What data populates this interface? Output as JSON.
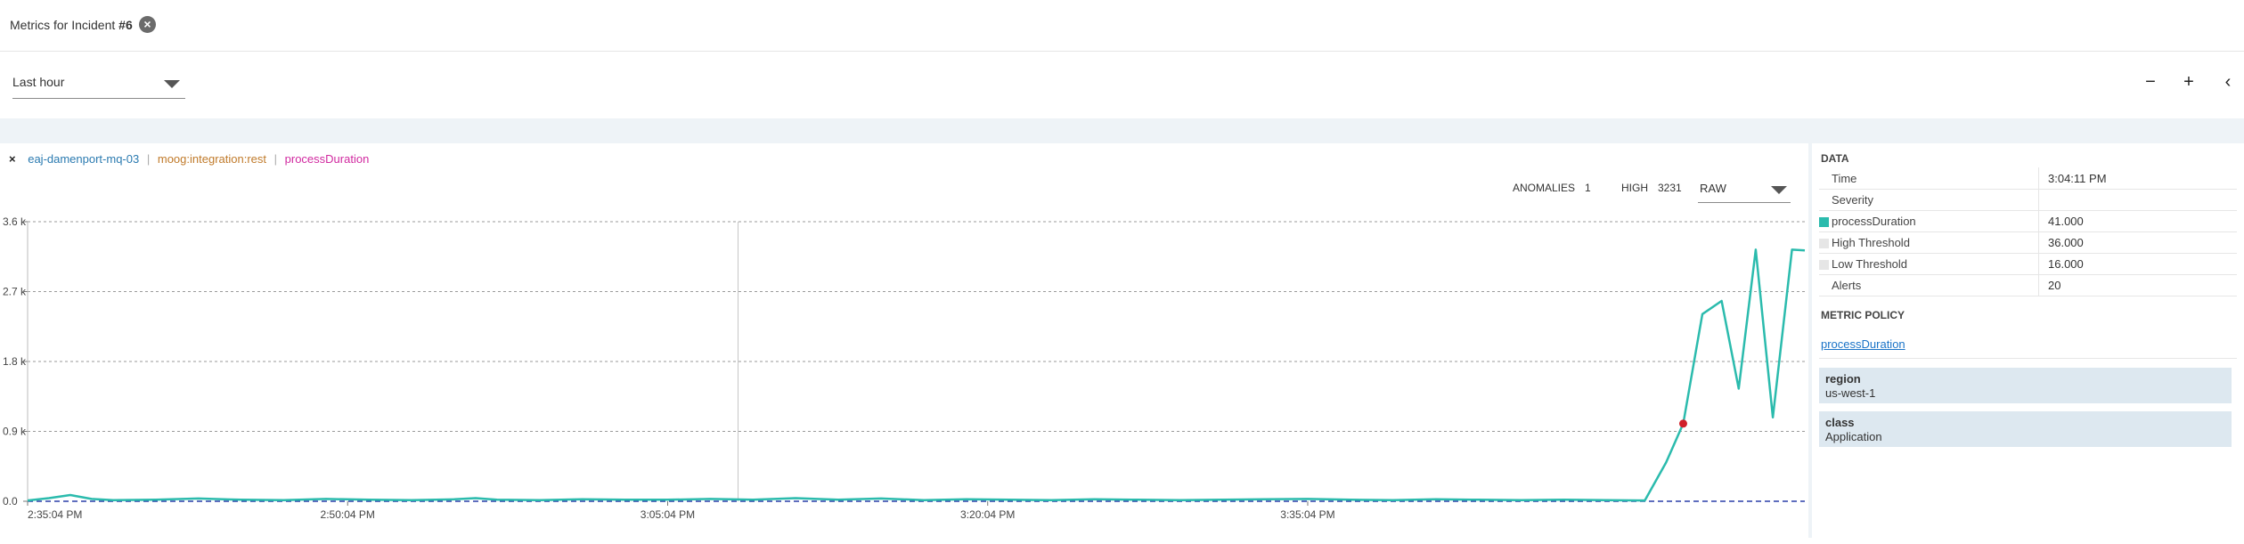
{
  "header": {
    "title_prefix": "Metrics for Incident",
    "title_num": "#6"
  },
  "toolbar": {
    "time_range": "Last hour",
    "buttons": {
      "zoom_out": "−",
      "zoom_in": "+",
      "collapse": "‹"
    }
  },
  "legend": {
    "close": "×",
    "host": "eaj-damenport-mq-03",
    "source": "moog:integration:rest",
    "metric": "processDuration",
    "separator": "|"
  },
  "stats": {
    "anomalies_label": "ANOMALIES",
    "anomalies_value": "1",
    "high_label": "HIGH",
    "high_value": "3231",
    "mode": "RAW"
  },
  "data_panel": {
    "heading": "DATA",
    "rows": [
      {
        "label": "Time",
        "value": "3:04:11 PM"
      },
      {
        "label": "Severity",
        "value": ""
      },
      {
        "label": "processDuration",
        "value": "41.000",
        "swatch": "#2bbbad"
      },
      {
        "label": "High Threshold",
        "value": "36.000",
        "swatch": "#e6e6e6"
      },
      {
        "label": "Low Threshold",
        "value": "16.000",
        "swatch": "#e6e6e6"
      },
      {
        "label": "Alerts",
        "value": "20"
      }
    ],
    "policy_heading": "METRIC POLICY",
    "policy_link": "processDuration",
    "tags": [
      {
        "key": "region",
        "value": "us-west-1"
      },
      {
        "key": "class",
        "value": "Application"
      }
    ]
  },
  "colors": {
    "line": "#2bbbad",
    "anomaly": "#d0202a",
    "baseline": "#2a3fa8",
    "accent": "#1a73c7"
  },
  "chart_data": {
    "type": "line",
    "xlabel": "",
    "ylabel": "",
    "y_ticks": [
      "0.0",
      "0.9 k",
      "1.8 k",
      "2.7 k",
      "3.6 k"
    ],
    "x_ticks": [
      "2:35:04 PM",
      "2:50:04 PM",
      "3:05:04 PM",
      "3:20:04 PM",
      "3:35:04 PM"
    ],
    "ylim": [
      0,
      3600
    ],
    "xlim_minutes": [
      0,
      82
    ],
    "grid": true,
    "cursor_minute": 33.3,
    "baseline_value": 0,
    "series": [
      {
        "name": "processDuration",
        "points": [
          [
            0,
            10
          ],
          [
            1,
            40
          ],
          [
            2,
            80
          ],
          [
            3,
            30
          ],
          [
            4,
            15
          ],
          [
            6,
            20
          ],
          [
            8,
            35
          ],
          [
            10,
            20
          ],
          [
            12,
            15
          ],
          [
            14,
            30
          ],
          [
            16,
            20
          ],
          [
            18,
            15
          ],
          [
            20,
            25
          ],
          [
            21,
            40
          ],
          [
            22,
            20
          ],
          [
            24,
            15
          ],
          [
            26,
            25
          ],
          [
            28,
            20
          ],
          [
            30,
            20
          ],
          [
            32,
            30
          ],
          [
            34,
            20
          ],
          [
            36,
            40
          ],
          [
            38,
            20
          ],
          [
            40,
            35
          ],
          [
            42,
            15
          ],
          [
            44,
            25
          ],
          [
            46,
            20
          ],
          [
            48,
            15
          ],
          [
            50,
            25
          ],
          [
            52,
            20
          ],
          [
            54,
            15
          ],
          [
            56,
            20
          ],
          [
            58,
            25
          ],
          [
            60,
            30
          ],
          [
            62,
            20
          ],
          [
            64,
            15
          ],
          [
            66,
            25
          ],
          [
            68,
            20
          ],
          [
            70,
            15
          ],
          [
            72,
            20
          ],
          [
            74,
            15
          ],
          [
            75.8,
            10
          ],
          [
            76.8,
            500
          ],
          [
            77.6,
            1000
          ],
          [
            78.5,
            2410
          ],
          [
            79.4,
            2580
          ],
          [
            80.2,
            1450
          ],
          [
            81,
            3240
          ],
          [
            81.8,
            1080
          ],
          [
            82.7,
            3240
          ],
          [
            83.3,
            3230
          ]
        ]
      }
    ],
    "anomalies": [
      [
        77.6,
        1000
      ]
    ]
  }
}
